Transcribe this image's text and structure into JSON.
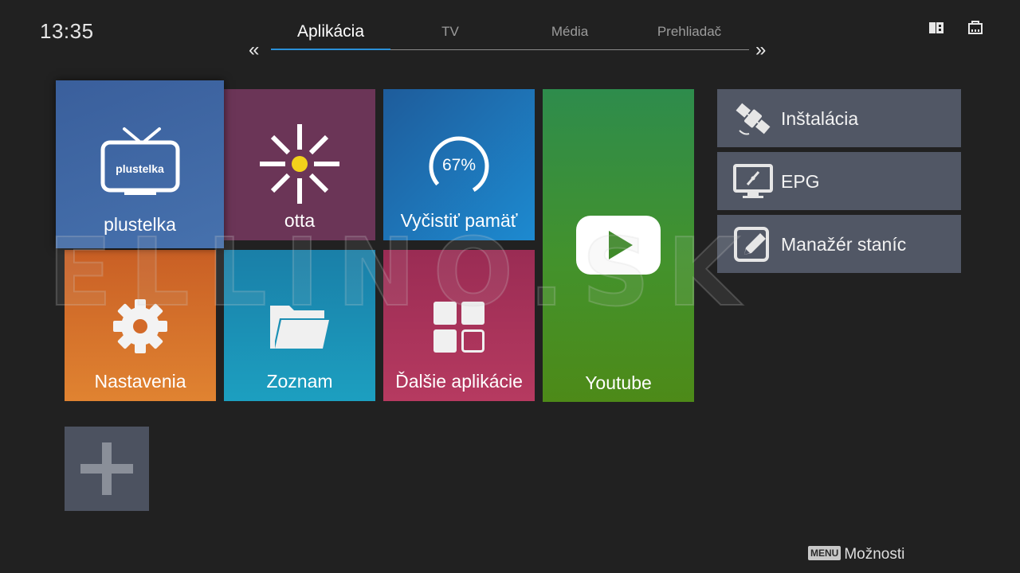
{
  "clock": "13:35",
  "tabs": [
    {
      "label": "Aplikácia",
      "active": true
    },
    {
      "label": "TV",
      "active": false
    },
    {
      "label": "Média",
      "active": false
    },
    {
      "label": "Prehliadač",
      "active": false
    }
  ],
  "nav": {
    "prev": "«",
    "next": "»"
  },
  "status_icons": [
    "sd-card-icon",
    "ethernet-icon"
  ],
  "tiles": {
    "plustelka": {
      "label": "plustelka",
      "logo_text": "plustelka",
      "icon": "tv-icon",
      "focused": true
    },
    "otta": {
      "label": "otta",
      "icon": "otta-sun-icon"
    },
    "clean": {
      "label": "Vyčistiť pamäť",
      "percent": "67%",
      "percent_value": 67,
      "icon": "memory-gauge-icon"
    },
    "youtube": {
      "label": "Youtube",
      "icon": "youtube-play-icon"
    },
    "settings": {
      "label": "Nastavenia",
      "icon": "gear-icon"
    },
    "list": {
      "label": "Zoznam",
      "icon": "folder-icon"
    },
    "more": {
      "label": "Ďalšie aplikácie",
      "icon": "apps-grid-icon"
    },
    "add": {
      "icon": "plus-icon"
    }
  },
  "side_menu": [
    {
      "label": "Inštalácia",
      "icon": "satellite-icon"
    },
    {
      "label": "EPG",
      "icon": "monitor-compass-icon"
    },
    {
      "label": "Manažér staníc",
      "icon": "edit-pencil-icon"
    }
  ],
  "watermark": "ELLINO.SK",
  "footer": {
    "key": "MENU",
    "label": "Možnosti"
  },
  "colors": {
    "background": "#212121",
    "active_tab_underline": "#2a90d8",
    "otta_sun": "#f2d21b"
  }
}
